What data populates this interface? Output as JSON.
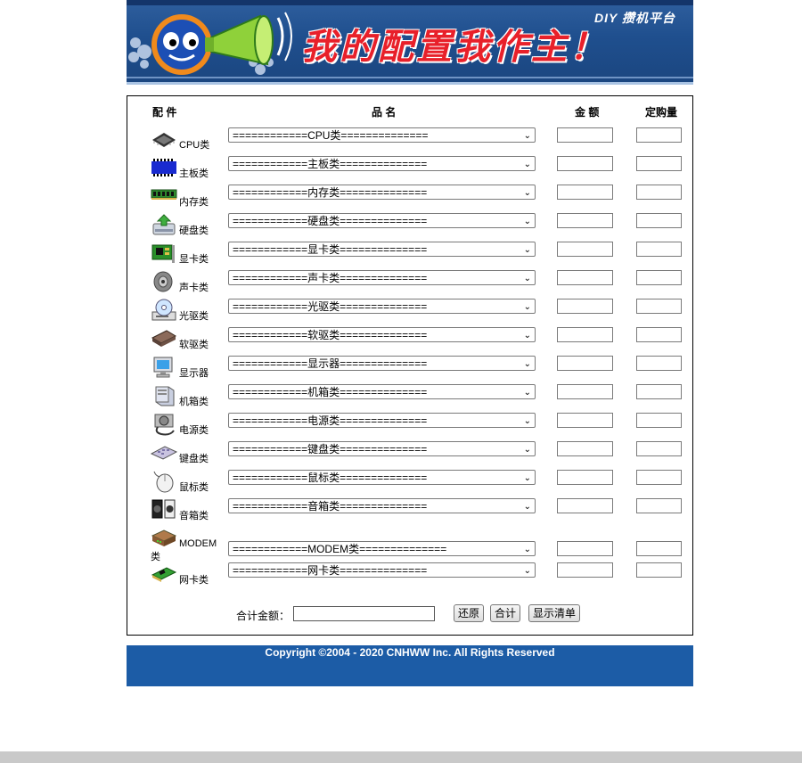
{
  "banner": {
    "title": "我的配置我作主！",
    "brand": "DIY 攒机平台"
  },
  "table_headers": {
    "part": "配 件",
    "name": "品 名",
    "price": "金 额",
    "qty": "定购量"
  },
  "rows": [
    {
      "label": "CPU类",
      "option": "============CPU类=============="
    },
    {
      "label": "主板类",
      "option": "============主板类=============="
    },
    {
      "label": "内存类",
      "option": "============内存类=============="
    },
    {
      "label": "硬盘类",
      "option": "============硬盘类=============="
    },
    {
      "label": "显卡类",
      "option": "============显卡类=============="
    },
    {
      "label": "声卡类",
      "option": "============声卡类=============="
    },
    {
      "label": "光驱类",
      "option": "============光驱类=============="
    },
    {
      "label": "软驱类",
      "option": "============软驱类=============="
    },
    {
      "label": "显示器",
      "option": "============显示器=============="
    },
    {
      "label": "机箱类",
      "option": "============机箱类=============="
    },
    {
      "label": "电源类",
      "option": "============电源类=============="
    },
    {
      "label": "键盘类",
      "option": "============键盘类=============="
    },
    {
      "label": "鼠标类",
      "option": "============鼠标类=============="
    },
    {
      "label": "音箱类",
      "option": "============音箱类=============="
    },
    {
      "label": "MODEM类",
      "option": "============MODEM类=============="
    },
    {
      "label": "网卡类",
      "option": "============网卡类=============="
    }
  ],
  "total": {
    "label": "合计金额：",
    "value": ""
  },
  "buttons": {
    "reset": "还原",
    "sum": "合计",
    "list": "显示清单"
  },
  "footer": {
    "copyright": "Copyright ©2004 - 2020 CNHWW Inc. All Rights Reserved"
  },
  "icons": [
    "cpu-icon",
    "motherboard-icon",
    "memory-icon",
    "harddisk-icon",
    "graphics-card-icon",
    "speaker-icon",
    "cdrom-icon",
    "floppy-drive-icon",
    "monitor-icon",
    "case-icon",
    "power-supply-icon",
    "keyboard-icon",
    "mouse-icon",
    "speakers-icon",
    "modem-icon",
    "network-card-icon"
  ]
}
